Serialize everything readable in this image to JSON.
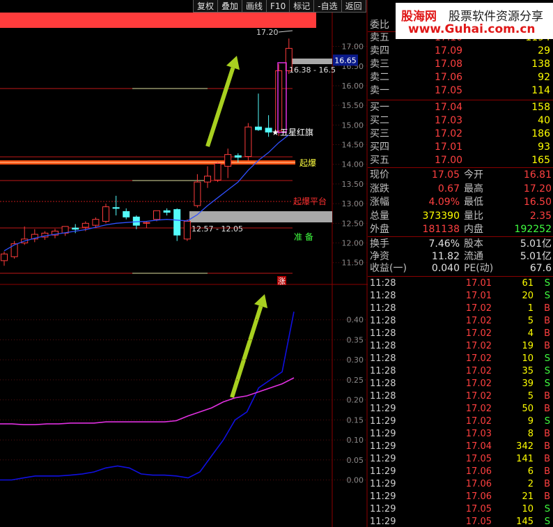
{
  "toolbar": [
    "复权",
    "叠加",
    "画线",
    "F10",
    "标记",
    "-自选",
    "返回"
  ],
  "watermark": {
    "brand": "股海网",
    "slogan": "股票软件资源分享",
    "url": "www.Guhai.com.cn"
  },
  "chart": {
    "price_axis": [
      "17.00",
      "16.50",
      "16.00",
      "15.50",
      "15.00",
      "14.50",
      "14.00",
      "13.50",
      "13.00",
      "12.50",
      "12.00",
      "11.50"
    ],
    "current_price_tag": "16.65",
    "high_tag": "17.20",
    "range_upper": "16.38 - 16.5",
    "range_lower": "12.57 - 12.05",
    "signal_star": "五星红旗",
    "signal_breakout": "起爆",
    "signal_platform": "起爆平台",
    "signal_prepare": "准 备",
    "limit_up_badge": "涨",
    "indicator_axis": [
      "0.40",
      "0.35",
      "0.30",
      "0.25",
      "0.20",
      "0.15",
      "0.10",
      "0.05",
      "0.00"
    ],
    "colors": {
      "up": "#ff3c3c",
      "down": "#54fcfc",
      "ma": "#3050ff",
      "indicator1": "#1010e0",
      "indicator2": "#e030e0",
      "arrow": "#a8d020"
    }
  },
  "chart_data": {
    "type": "candlestick",
    "candles": [
      {
        "o": 11.55,
        "h": 11.78,
        "l": 11.42,
        "c": 11.72
      },
      {
        "o": 11.65,
        "h": 12.05,
        "l": 11.6,
        "c": 11.98
      },
      {
        "o": 12.0,
        "h": 12.42,
        "l": 11.95,
        "c": 12.1
      },
      {
        "o": 12.1,
        "h": 12.35,
        "l": 12.02,
        "c": 12.22
      },
      {
        "o": 12.15,
        "h": 12.3,
        "l": 12.08,
        "c": 12.25
      },
      {
        "o": 12.2,
        "h": 12.36,
        "l": 12.12,
        "c": 12.3
      },
      {
        "o": 12.25,
        "h": 12.4,
        "l": 12.18,
        "c": 12.42
      },
      {
        "o": 12.38,
        "h": 12.48,
        "l": 12.25,
        "c": 12.35
      },
      {
        "o": 12.4,
        "h": 12.55,
        "l": 12.3,
        "c": 12.5
      },
      {
        "o": 12.45,
        "h": 12.65,
        "l": 12.38,
        "c": 12.6
      },
      {
        "o": 12.55,
        "h": 13.0,
        "l": 12.5,
        "c": 12.92
      },
      {
        "o": 12.9,
        "h": 13.2,
        "l": 12.7,
        "c": 12.88
      },
      {
        "o": 12.8,
        "h": 12.88,
        "l": 12.6,
        "c": 12.66
      },
      {
        "o": 12.66,
        "h": 12.7,
        "l": 12.35,
        "c": 12.45
      },
      {
        "o": 12.5,
        "h": 12.55,
        "l": 12.38,
        "c": 12.52
      },
      {
        "o": 12.6,
        "h": 12.8,
        "l": 12.55,
        "c": 12.82
      },
      {
        "o": 12.82,
        "h": 12.88,
        "l": 12.7,
        "c": 12.78
      },
      {
        "o": 12.85,
        "h": 12.88,
        "l": 12.05,
        "c": 12.2
      },
      {
        "o": 12.1,
        "h": 12.6,
        "l": 12.05,
        "c": 12.55
      },
      {
        "o": 12.95,
        "h": 13.75,
        "l": 12.9,
        "c": 13.55
      },
      {
        "o": 13.55,
        "h": 13.95,
        "l": 13.4,
        "c": 13.7
      },
      {
        "o": 13.6,
        "h": 14.05,
        "l": 13.55,
        "c": 14.02
      },
      {
        "o": 13.95,
        "h": 14.4,
        "l": 13.65,
        "c": 14.25
      },
      {
        "o": 14.22,
        "h": 14.28,
        "l": 14.05,
        "c": 14.18
      },
      {
        "o": 14.2,
        "h": 15.05,
        "l": 14.1,
        "c": 14.95
      },
      {
        "o": 14.95,
        "h": 15.8,
        "l": 14.85,
        "c": 14.88
      },
      {
        "o": 14.92,
        "h": 15.25,
        "l": 14.7,
        "c": 14.82
      },
      {
        "o": 14.85,
        "h": 16.55,
        "l": 14.72,
        "c": 16.38
      },
      {
        "o": 16.38,
        "h": 17.2,
        "l": 16.3,
        "c": 16.95
      }
    ],
    "ma": [
      11.8,
      11.95,
      12.05,
      12.12,
      12.18,
      12.22,
      12.26,
      12.3,
      12.34,
      12.4,
      12.46,
      12.5,
      12.52,
      12.54,
      12.55,
      12.58,
      12.6,
      12.58,
      12.56,
      12.72,
      12.95,
      13.15,
      13.35,
      13.55,
      13.85,
      14.1,
      14.3,
      14.55,
      14.75
    ],
    "indicator_series": [
      {
        "values": [
          0.0,
          0.0,
          0.005,
          0.01,
          0.01,
          0.01,
          0.012,
          0.015,
          0.02,
          0.03,
          0.035,
          0.03,
          0.015,
          0.012,
          0.012,
          0.01,
          0.005,
          0.02,
          0.06,
          0.1,
          0.15,
          0.17,
          0.23,
          0.25,
          0.27,
          0.42
        ]
      },
      {
        "values": [
          0.14,
          0.14,
          0.138,
          0.138,
          0.14,
          0.14,
          0.142,
          0.142,
          0.142,
          0.145,
          0.145,
          0.145,
          0.145,
          0.145,
          0.145,
          0.148,
          0.16,
          0.17,
          0.18,
          0.195,
          0.205,
          0.21,
          0.22,
          0.23,
          0.24,
          0.255
        ]
      }
    ],
    "ylim_price": [
      11.3,
      17.4
    ],
    "ylim_indicator": [
      -0.02,
      0.45
    ]
  },
  "quote": {
    "weibi_label": "委比",
    "asks": [
      {
        "label": "卖五",
        "price": "17.10",
        "vol": "1194"
      },
      {
        "label": "卖四",
        "price": "17.09",
        "vol": "29"
      },
      {
        "label": "卖三",
        "price": "17.08",
        "vol": "138"
      },
      {
        "label": "卖二",
        "price": "17.06",
        "vol": "92"
      },
      {
        "label": "卖一",
        "price": "17.05",
        "vol": "114"
      }
    ],
    "bids": [
      {
        "label": "买一",
        "price": "17.04",
        "vol": "158"
      },
      {
        "label": "买二",
        "price": "17.03",
        "vol": "40"
      },
      {
        "label": "买三",
        "price": "17.02",
        "vol": "186"
      },
      {
        "label": "买四",
        "price": "17.01",
        "vol": "93"
      },
      {
        "label": "买五",
        "price": "17.00",
        "vol": "165"
      }
    ],
    "stats": [
      {
        "l1": "现价",
        "v1": "17.05",
        "c1": "#ff4040",
        "l2": "今开",
        "v2": "16.81",
        "c2": "#ff4040"
      },
      {
        "l1": "涨跌",
        "v1": "0.67",
        "c1": "#ff4040",
        "l2": "最高",
        "v2": "17.20",
        "c2": "#ff4040"
      },
      {
        "l1": "涨幅",
        "v1": "4.09%",
        "c1": "#ff4040",
        "l2": "最低",
        "v2": "16.50",
        "c2": "#ff4040"
      },
      {
        "l1": "总量",
        "v1": "373390",
        "c1": "#ffff00",
        "l2": "量比",
        "v2": "2.35",
        "c2": "#ff4040"
      },
      {
        "l1": "外盘",
        "v1": "181138",
        "c1": "#ff4040",
        "l2": "内盘",
        "v2": "192252",
        "c2": "#40ff40"
      }
    ],
    "fin": [
      {
        "l1": "换手",
        "v1": "7.46%",
        "l2": "股本",
        "v2": "5.01亿"
      },
      {
        "l1": "净资",
        "v1": "11.82",
        "l2": "流通",
        "v2": "5.01亿"
      },
      {
        "l1": "收益(一)",
        "v1": "0.040",
        "l2": "PE(动)",
        "v2": "67.6"
      }
    ],
    "ticks": [
      {
        "time": "11:28",
        "price": "17.01",
        "vol": "61",
        "bs": "S"
      },
      {
        "time": "11:28",
        "price": "17.01",
        "vol": "20",
        "bs": "S"
      },
      {
        "time": "11:28",
        "price": "17.02",
        "vol": "1",
        "bs": "B"
      },
      {
        "time": "11:28",
        "price": "17.02",
        "vol": "5",
        "bs": "B"
      },
      {
        "time": "11:28",
        "price": "17.02",
        "vol": "4",
        "bs": "B"
      },
      {
        "time": "11:28",
        "price": "17.02",
        "vol": "19",
        "bs": "B"
      },
      {
        "time": "11:28",
        "price": "17.02",
        "vol": "10",
        "bs": "S"
      },
      {
        "time": "11:28",
        "price": "17.02",
        "vol": "35",
        "bs": "S"
      },
      {
        "time": "11:28",
        "price": "17.02",
        "vol": "39",
        "bs": "S"
      },
      {
        "time": "11:28",
        "price": "17.02",
        "vol": "5",
        "bs": "B"
      },
      {
        "time": "11:29",
        "price": "17.02",
        "vol": "50",
        "bs": "B"
      },
      {
        "time": "11:29",
        "price": "17.02",
        "vol": "9",
        "bs": "S"
      },
      {
        "time": "11:29",
        "price": "17.03",
        "vol": "8",
        "bs": "B"
      },
      {
        "time": "11:29",
        "price": "17.04",
        "vol": "342",
        "bs": "B"
      },
      {
        "time": "11:29",
        "price": "17.05",
        "vol": "141",
        "bs": "B"
      },
      {
        "time": "11:29",
        "price": "17.06",
        "vol": "6",
        "bs": "B"
      },
      {
        "time": "11:29",
        "price": "17.06",
        "vol": "2",
        "bs": "B"
      },
      {
        "time": "11:29",
        "price": "17.06",
        "vol": "21",
        "bs": "B"
      },
      {
        "time": "11:29",
        "price": "17.05",
        "vol": "10",
        "bs": "S"
      },
      {
        "time": "11:29",
        "price": "17.05",
        "vol": "145",
        "bs": "S"
      }
    ]
  }
}
